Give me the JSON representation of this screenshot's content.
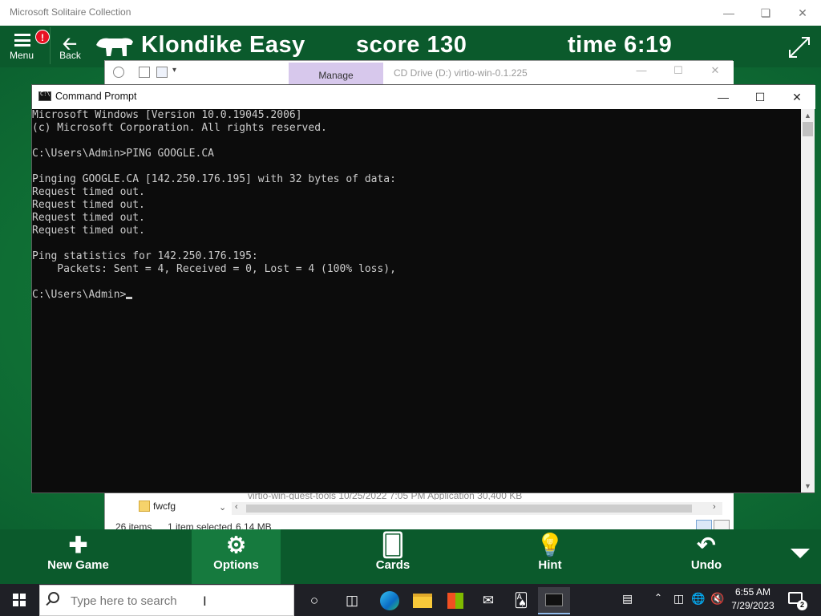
{
  "solitaire": {
    "window_title": "Microsoft Solitaire Collection",
    "menu_label": "Menu",
    "menu_badge": "!",
    "back_label": "Back",
    "game_title": "Klondike  Easy",
    "score": "score 130",
    "time": "time 6:19",
    "bottom_bar": [
      {
        "label": "New Game",
        "icon": "plus-icon"
      },
      {
        "label": "Options",
        "icon": "gear-icon"
      },
      {
        "label": "Cards",
        "icon": "cards-icon"
      },
      {
        "label": "Hint",
        "icon": "lightbulb-icon"
      },
      {
        "label": "Undo",
        "icon": "undo-icon"
      }
    ]
  },
  "explorer": {
    "title": "CD Drive (D:) virtio-win-0.1.225",
    "manage_tab": "Manage",
    "partial_row": "virtio-win-guest-tools          10/25/2022 7:05 PM        Application              30,400 KB",
    "folder_item": "fwcfg",
    "status": {
      "items": "26 items",
      "selected": "1 item selected",
      "size": "6.14 MB"
    }
  },
  "cmd": {
    "title": "Command Prompt",
    "lines": [
      "Microsoft Windows [Version 10.0.19045.2006]",
      "(c) Microsoft Corporation. All rights reserved.",
      "",
      "C:\\Users\\Admin>PING GOOGLE.CA",
      "",
      "Pinging GOOGLE.CA [142.250.176.195] with 32 bytes of data:",
      "Request timed out.",
      "Request timed out.",
      "Request timed out.",
      "Request timed out.",
      "",
      "Ping statistics for 142.250.176.195:",
      "    Packets: Sent = 4, Received = 0, Lost = 4 (100% loss),",
      ""
    ],
    "prompt": "C:\\Users\\Admin>"
  },
  "taskbar": {
    "search_placeholder": "Type here to search",
    "pinned": [
      "cortana-icon",
      "task-view-icon",
      "edge-icon",
      "file-explorer-icon",
      "store-icon",
      "mail-icon",
      "solitaire-icon",
      "command-prompt-icon"
    ],
    "time": "6:55 AM",
    "date": "7/29/2023",
    "notification_count": "2"
  }
}
